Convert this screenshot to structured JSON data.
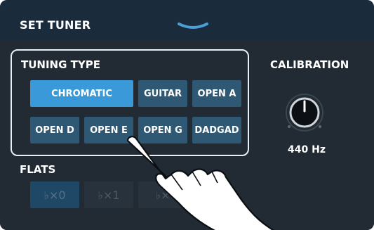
{
  "header": {
    "title": "SET TUNER"
  },
  "tuning": {
    "label": "TUNING TYPE",
    "buttons": [
      {
        "label": "CHROMATIC",
        "selected": true
      },
      {
        "label": "GUITAR",
        "selected": false
      },
      {
        "label": "OPEN A",
        "selected": false
      },
      {
        "label": "OPEN D",
        "selected": false
      },
      {
        "label": "OPEN E",
        "selected": false
      },
      {
        "label": "OPEN G",
        "selected": false
      },
      {
        "label": "DADGAD",
        "selected": false
      }
    ]
  },
  "calibration": {
    "label": "CALIBRATION",
    "value": "440 Hz"
  },
  "flats": {
    "label": "FLATS",
    "buttons": [
      {
        "label": "♭×0",
        "selected": true
      },
      {
        "label": "♭×1",
        "selected": false
      },
      {
        "label": "♭×",
        "selected": false
      }
    ]
  },
  "colors": {
    "header_bg": "#1a2b3c",
    "panel_bg": "#222a33",
    "button": "#2e5874",
    "button_selected": "#3a99d8"
  }
}
